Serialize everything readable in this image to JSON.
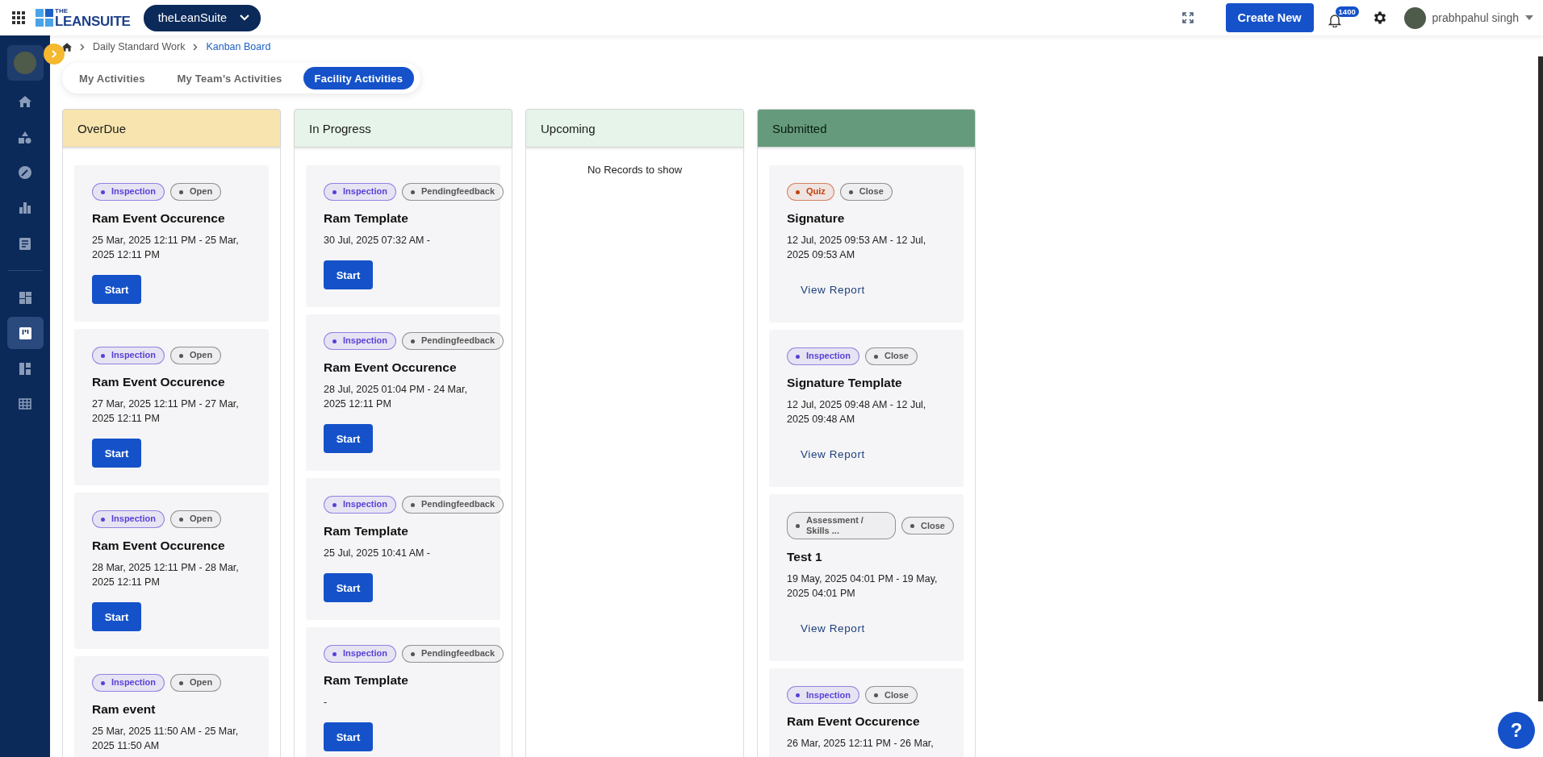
{
  "topbar": {
    "logo_small": "THE",
    "logo": "LEANSUITE",
    "workspace": "theLeanSuite",
    "create_button": "Create New",
    "notifications": "1400",
    "user": "prabhpahul singh"
  },
  "sidebar": {
    "groups": [
      {
        "items": [
          {
            "kind": "home",
            "selected": false
          },
          {
            "kind": "shapes",
            "selected": false
          },
          {
            "kind": "gauge",
            "selected": false
          },
          {
            "kind": "chart",
            "selected": false
          },
          {
            "kind": "doc",
            "selected": false
          }
        ]
      },
      {
        "items": [
          {
            "kind": "dashboard",
            "selected": false
          },
          {
            "kind": "kanban",
            "selected": true
          },
          {
            "kind": "layout",
            "selected": false
          },
          {
            "kind": "grid",
            "selected": false
          }
        ]
      }
    ]
  },
  "breadcrumb": [
    "Daily Standard Work",
    "Kanban Board"
  ],
  "tabs": [
    {
      "label": "My Activities",
      "selected": false
    },
    {
      "label": "My Team’s Activities",
      "selected": false
    },
    {
      "label": "Facility Activities",
      "selected": true
    }
  ],
  "columns": [
    {
      "title": "OverDue",
      "color": "#f7e4ae",
      "cards": [
        {
          "tags": [
            {
              "label": "Inspection",
              "color": "#5b3fd6"
            },
            {
              "label": "Open",
              "color": "#555555"
            }
          ],
          "title": "Ram Event Occurence",
          "dates": "25 Mar, 2025 12:11 PM - 25 Mar, 2025 12:11 PM",
          "action": {
            "kind": "start",
            "label": "Start"
          }
        },
        {
          "tags": [
            {
              "label": "Inspection",
              "color": "#5b3fd6"
            },
            {
              "label": "Open",
              "color": "#555555"
            }
          ],
          "title": "Ram Event Occurence",
          "dates": "27 Mar, 2025 12:11 PM - 27 Mar, 2025 12:11 PM",
          "action": {
            "kind": "start",
            "label": "Start"
          }
        },
        {
          "tags": [
            {
              "label": "Inspection",
              "color": "#5b3fd6"
            },
            {
              "label": "Open",
              "color": "#555555"
            }
          ],
          "title": "Ram Event Occurence",
          "dates": "28 Mar, 2025 12:11 PM - 28 Mar, 2025 12:11 PM",
          "action": {
            "kind": "start",
            "label": "Start"
          }
        },
        {
          "tags": [
            {
              "label": "Inspection",
              "color": "#5b3fd6"
            },
            {
              "label": "Open",
              "color": "#555555"
            }
          ],
          "title": "Ram event",
          "dates": "25 Mar, 2025 11:50 AM - 25 Mar, 2025 11:50 AM"
        }
      ]
    },
    {
      "title": "In Progress",
      "color": "#e6f4ea",
      "cards": [
        {
          "tags": [
            {
              "label": "Inspection",
              "color": "#5b3fd6"
            },
            {
              "label": "Pendingfeedback",
              "color": "#555555"
            }
          ],
          "title": "Ram Template",
          "dates": "30 Jul, 2025 07:32 AM -",
          "action": {
            "kind": "start",
            "label": "Start"
          }
        },
        {
          "tags": [
            {
              "label": "Inspection",
              "color": "#5b3fd6"
            },
            {
              "label": "Pendingfeedback",
              "color": "#555555"
            }
          ],
          "title": "Ram Event Occurence",
          "dates": "28 Jul, 2025 01:04 PM - 24 Mar, 2025 12:11 PM",
          "action": {
            "kind": "start",
            "label": "Start"
          }
        },
        {
          "tags": [
            {
              "label": "Inspection",
              "color": "#5b3fd6"
            },
            {
              "label": "Pendingfeedback",
              "color": "#555555"
            }
          ],
          "title": "Ram Template",
          "dates": "25 Jul, 2025 10:41 AM -",
          "action": {
            "kind": "start",
            "label": "Start"
          }
        },
        {
          "tags": [
            {
              "label": "Inspection",
              "color": "#5b3fd6"
            },
            {
              "label": "Pendingfeedback",
              "color": "#555555"
            }
          ],
          "title": "Ram Template",
          "dates": "-",
          "action": {
            "kind": "start",
            "label": "Start"
          }
        }
      ]
    },
    {
      "title": "Upcoming",
      "color": "#e6f4ea",
      "empty_text": "No Records to show"
    },
    {
      "title": "Submitted",
      "color": "#659b7c",
      "cards": [
        {
          "tags": [
            {
              "label": "Quiz",
              "color": "#c2410c"
            },
            {
              "label": "Close",
              "color": "#555555"
            }
          ],
          "title": "Signature",
          "dates": "12 Jul, 2025 09:53 AM - 12 Jul, 2025 09:53 AM",
          "action": {
            "kind": "report",
            "label": "View Report"
          }
        },
        {
          "tags": [
            {
              "label": "Inspection",
              "color": "#5b3fd6"
            },
            {
              "label": "Close",
              "color": "#555555"
            }
          ],
          "title": "Signature Template",
          "dates": "12 Jul, 2025 09:48 AM - 12 Jul, 2025 09:48 AM",
          "action": {
            "kind": "report",
            "label": "View Report"
          }
        },
        {
          "tags": [
            {
              "label": "Assessment / Skills ...",
              "color": "#555555"
            },
            {
              "label": "Close",
              "color": "#555555"
            }
          ],
          "title": "Test 1",
          "dates": "19 May, 2025 04:01 PM - 19 May, 2025 04:01 PM",
          "action": {
            "kind": "report",
            "label": "View Report"
          }
        },
        {
          "tags": [
            {
              "label": "Inspection",
              "color": "#5b3fd6"
            },
            {
              "label": "Close",
              "color": "#555555"
            }
          ],
          "title": "Ram Event Occurence",
          "dates": "26 Mar, 2025 12:11 PM - 26 Mar,"
        }
      ]
    }
  ],
  "help_button": "?"
}
